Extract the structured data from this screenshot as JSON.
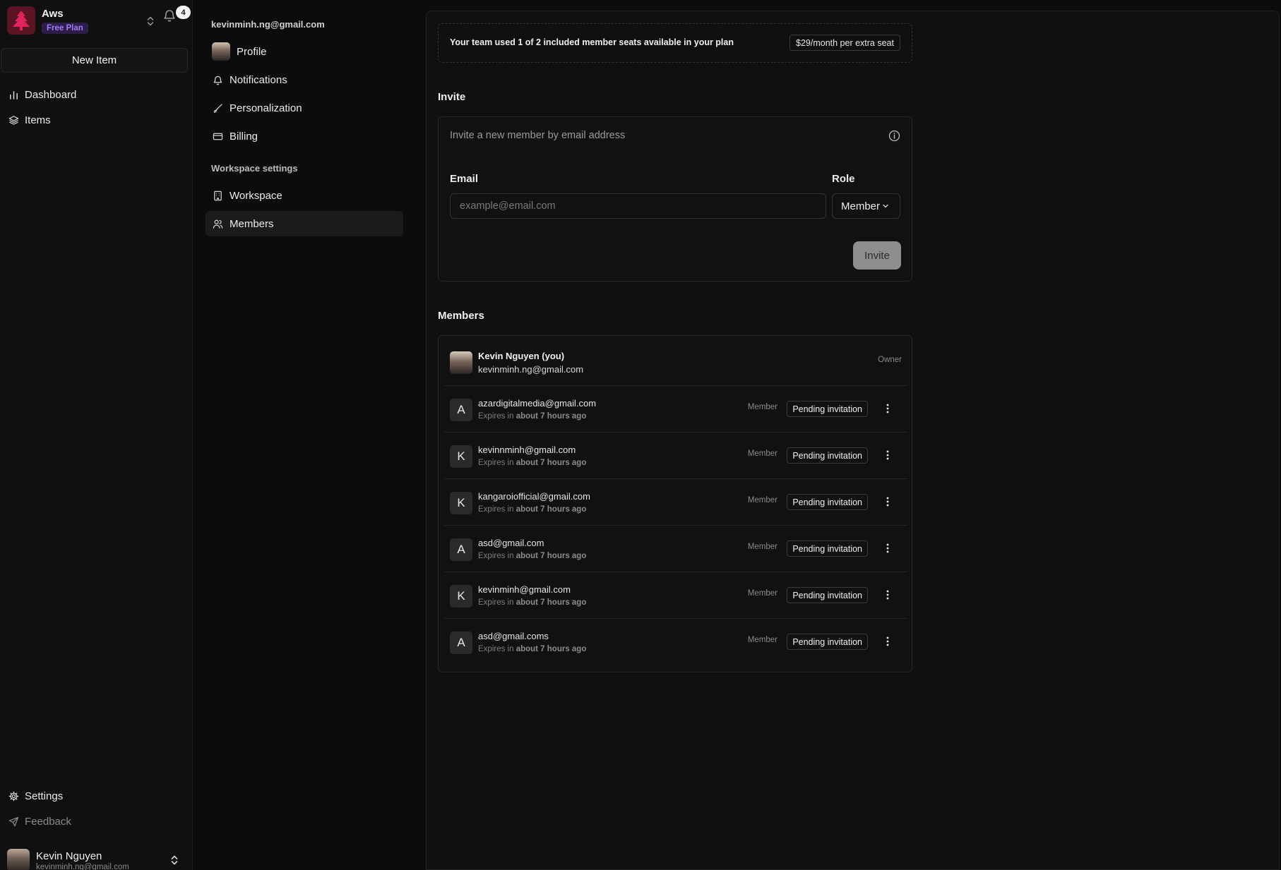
{
  "workspace": {
    "name": "Aws",
    "plan_badge": "Free Plan",
    "notification_count": "4"
  },
  "sidebar": {
    "new_item_label": "New Item",
    "nav": [
      {
        "label": "Dashboard",
        "icon": "bar-chart-icon"
      },
      {
        "label": "Items",
        "icon": "layers-icon"
      }
    ],
    "footer_nav": [
      {
        "label": "Settings",
        "icon": "gear-icon"
      },
      {
        "label": "Feedback",
        "icon": "send-icon"
      }
    ],
    "user": {
      "name": "Kevin Nguyen",
      "email": "kevinminh.ng@gmail.com"
    }
  },
  "settings_nav": {
    "account_email": "kevinminh.ng@gmail.com",
    "account_items": [
      {
        "label": "Profile",
        "icon": "avatar"
      },
      {
        "label": "Notifications",
        "icon": "bell-icon"
      },
      {
        "label": "Personalization",
        "icon": "brush-icon"
      },
      {
        "label": "Billing",
        "icon": "credit-card-icon"
      }
    ],
    "workspace_group_label": "Workspace settings",
    "workspace_items": [
      {
        "label": "Workspace",
        "icon": "building-icon"
      },
      {
        "label": "Members",
        "icon": "users-icon",
        "active": true
      }
    ]
  },
  "seats": {
    "text_prefix": "Your team used ",
    "used": "1",
    "of": " of ",
    "total": "2",
    "text_suffix": " included member seats available in your plan",
    "price": "$29/month per extra seat"
  },
  "invite": {
    "title": "Invite",
    "description": "Invite a new member by email address",
    "email_label": "Email",
    "email_placeholder": "example@email.com",
    "role_label": "Role",
    "role_value": "Member",
    "button_label": "Invite"
  },
  "members": {
    "title": "Members",
    "owner": {
      "name": "Kevin Nguyen (you)",
      "email": "kevinminh.ng@gmail.com",
      "role": "Owner"
    },
    "invitations": [
      {
        "initial": "A",
        "email": "azardigitalmedia@gmail.com",
        "expires_prefix": "Expires in ",
        "expires_value": "about 7 hours ago",
        "role": "Member",
        "status": "Pending invitation"
      },
      {
        "initial": "K",
        "email": "kevinnminh@gmail.com",
        "expires_prefix": "Expires in ",
        "expires_value": "about 7 hours ago",
        "role": "Member",
        "status": "Pending invitation"
      },
      {
        "initial": "K",
        "email": "kangaroiofficial@gmail.com",
        "expires_prefix": "Expires in ",
        "expires_value": "about 7 hours ago",
        "role": "Member",
        "status": "Pending invitation"
      },
      {
        "initial": "A",
        "email": "asd@gmail.com",
        "expires_prefix": "Expires in ",
        "expires_value": "about 7 hours ago",
        "role": "Member",
        "status": "Pending invitation"
      },
      {
        "initial": "K",
        "email": "kevinminh@gmail.com",
        "expires_prefix": "Expires in ",
        "expires_value": "about 7 hours ago",
        "role": "Member",
        "status": "Pending invitation"
      },
      {
        "initial": "A",
        "email": "asd@gmail.coms",
        "expires_prefix": "Expires in ",
        "expires_value": "about 7 hours ago",
        "role": "Member",
        "status": "Pending invitation"
      }
    ]
  },
  "colors": {
    "background": "#0c0c0c",
    "panel": "#101010",
    "accent_purple": "#a47bf6",
    "logo_red": "#e0245e"
  }
}
